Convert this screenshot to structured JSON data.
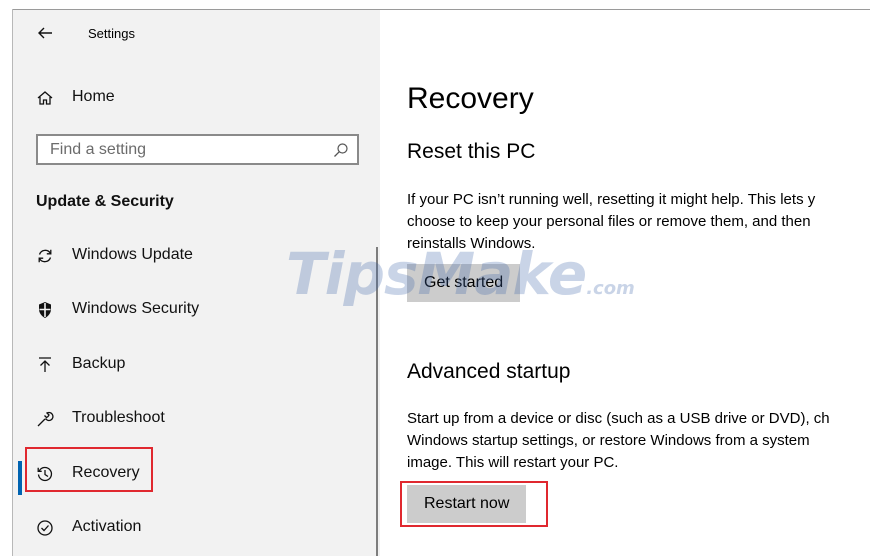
{
  "window": {
    "title": "Settings"
  },
  "sidebar": {
    "home_label": "Home",
    "search_placeholder": "Find a setting",
    "section_title": "Update & Security",
    "items": [
      {
        "label": "Windows Update",
        "icon": "sync-icon"
      },
      {
        "label": "Windows Security",
        "icon": "shield-icon"
      },
      {
        "label": "Backup",
        "icon": "upload-arrow-icon"
      },
      {
        "label": "Troubleshoot",
        "icon": "wrench-icon"
      },
      {
        "label": "Recovery",
        "icon": "history-clock-icon",
        "selected": true
      },
      {
        "label": "Activation",
        "icon": "check-circle-icon"
      }
    ]
  },
  "main": {
    "title": "Recovery",
    "reset": {
      "heading": "Reset this PC",
      "lines": [
        "If your PC isn’t running well, resetting it might help. This lets y",
        "choose to keep your personal files or remove them, and then",
        "reinstalls Windows."
      ],
      "button": "Get started"
    },
    "advanced": {
      "heading": "Advanced startup",
      "lines": [
        "Start up from a device or disc (such as a USB drive or DVD), ch",
        "Windows startup settings, or restore Windows from a system",
        "image. This will restart your PC."
      ],
      "button": "Restart now"
    }
  },
  "watermark": {
    "main": "TipsMake",
    "suffix": ".com"
  },
  "colors": {
    "accent": "#0063b1",
    "highlight": "#e0282f",
    "sidebar_bg": "#f2f2f2",
    "button_bg": "#cccccc"
  }
}
